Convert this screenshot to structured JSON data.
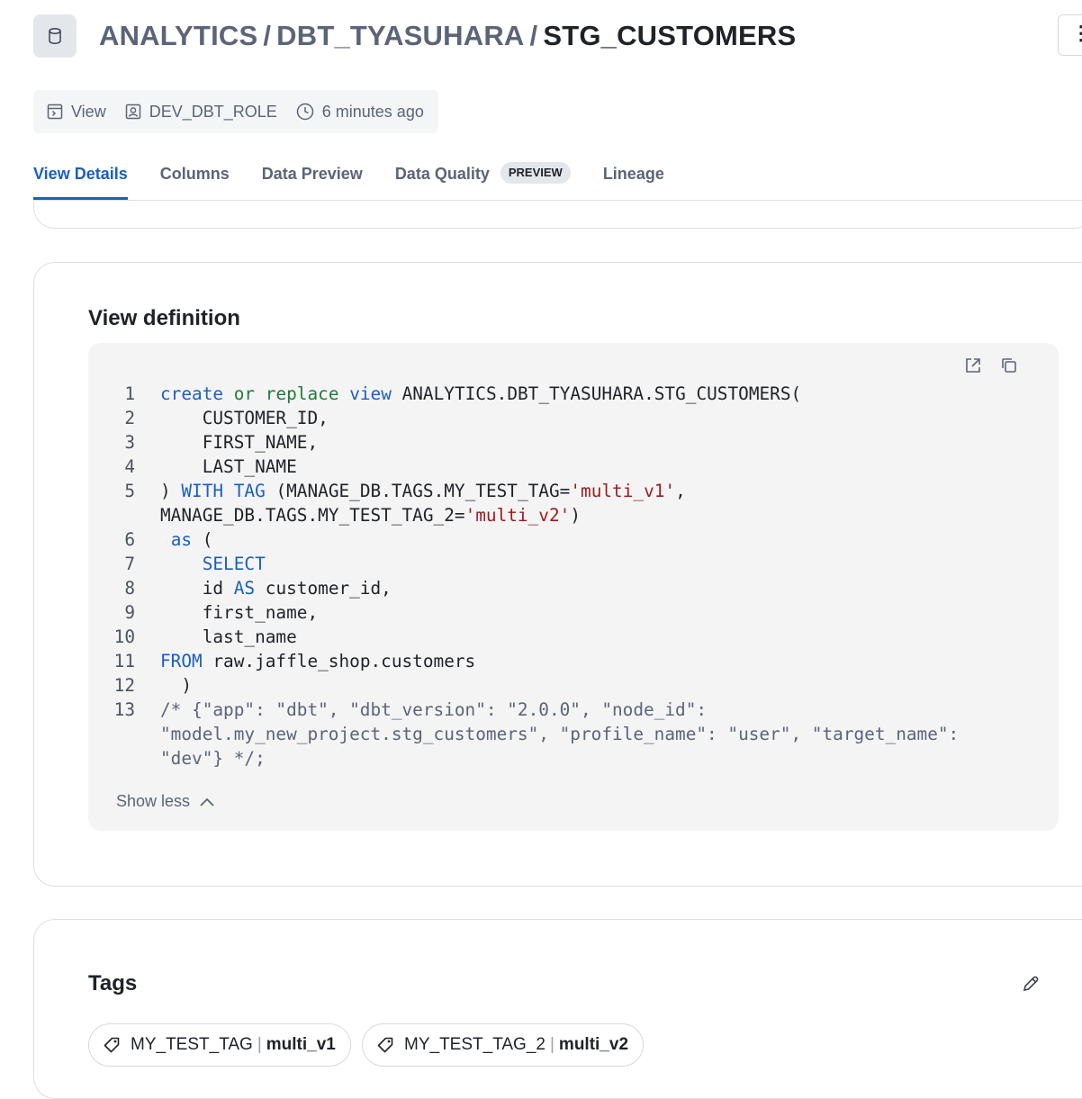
{
  "header": {
    "crumbs": [
      "ANALYTICS",
      "DBT_TYASUHARA"
    ],
    "separator": "/",
    "current": "STG_CUSTOMERS",
    "more_label": "⋮"
  },
  "meta": {
    "type": "View",
    "role": "DEV_DBT_ROLE",
    "modified": "6 minutes ago"
  },
  "tabs": [
    {
      "label": "View Details",
      "active": true
    },
    {
      "label": "Columns"
    },
    {
      "label": "Data Preview"
    },
    {
      "label": "Data Quality",
      "badge": "PREVIEW"
    },
    {
      "label": "Lineage"
    }
  ],
  "view_definition": {
    "title": "View definition",
    "line_numbers": [
      "1",
      "2",
      "3",
      "4",
      "5",
      "6",
      "7",
      "8",
      "9",
      "10",
      "11",
      "12",
      "13"
    ],
    "code": {
      "l1": {
        "kw1": "create",
        "kw2": "or",
        "kw3": "replace",
        "kw4": "view",
        "rest": " ANALYTICS.DBT_TYASUHARA.STG_CUSTOMERS("
      },
      "l2": "    CUSTOMER_ID,",
      "l3": "    FIRST_NAME,",
      "l4": "    LAST_NAME",
      "l5": {
        "pre": ") ",
        "kw1": "WITH",
        "kw2": "TAG",
        "mid": " (MANAGE_DB.TAGS.MY_TEST_TAG=",
        "str": "'multi_v1'",
        "post": ","
      },
      "l5b": {
        "pre": "MANAGE_DB.TAGS.MY_TEST_TAG_2=",
        "str": "'multi_v2'",
        "post": ")"
      },
      "l6": {
        "kw": "as",
        "rest": " ("
      },
      "l7": "SELECT",
      "l8": {
        "pre": "    id ",
        "kw": "AS",
        "rest": " customer_id,"
      },
      "l9": "    first_name,",
      "l10": "    last_name",
      "l11": {
        "kw": "FROM",
        "rest": " raw.jaffle_shop.customers"
      },
      "l12": "  )",
      "l13a": "/* {\"app\": \"dbt\", \"dbt_version\": \"2.0.0\", \"node_id\":",
      "l13b": "\"model.my_new_project.stg_customers\", \"profile_name\": \"user\", \"target_name\":",
      "l13c": "\"dev\"} */;"
    },
    "show_less_label": "Show less"
  },
  "tags_section": {
    "title": "Tags",
    "tags": [
      {
        "name": "MY_TEST_TAG",
        "value": "multi_v1"
      },
      {
        "name": "MY_TEST_TAG_2",
        "value": "multi_v2"
      }
    ]
  }
}
